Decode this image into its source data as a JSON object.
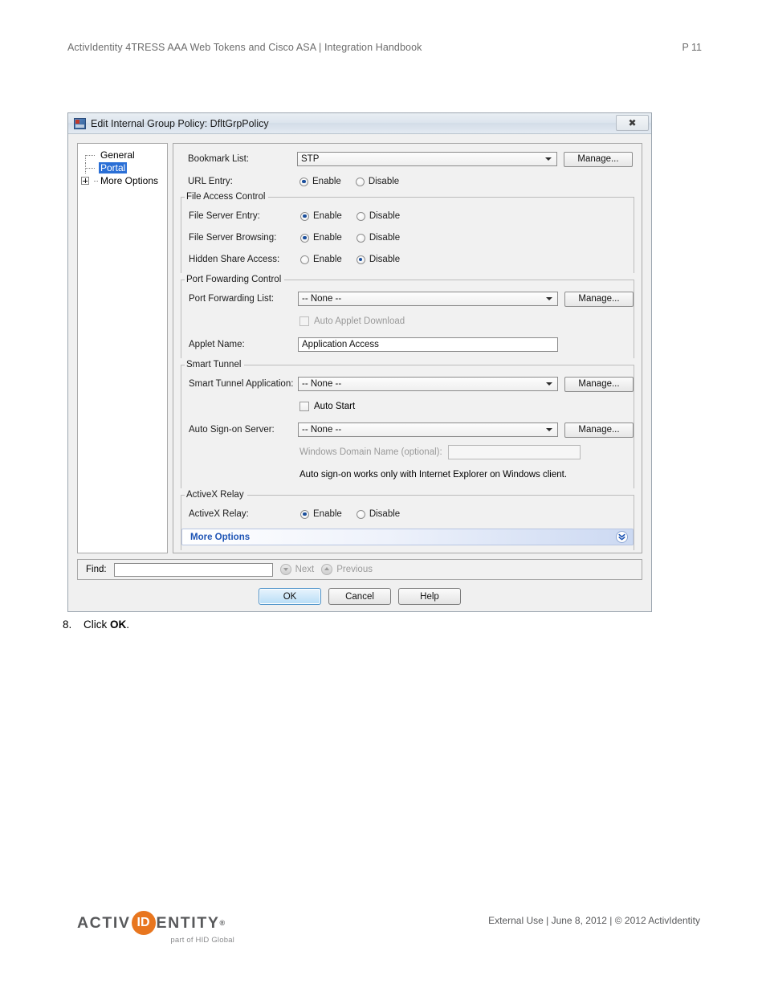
{
  "page_header": {
    "title": "ActivIdentity 4TRESS AAA Web Tokens and Cisco ASA | Integration Handbook",
    "page_number": "P 11"
  },
  "dialog": {
    "title": "Edit Internal Group Policy: DfltGrpPolicy",
    "close_label": "✖",
    "icon": "policy-window-icon",
    "tree": {
      "items": [
        {
          "label": "General",
          "selected": false,
          "expandable": false
        },
        {
          "label": "Portal",
          "selected": true,
          "expandable": false
        },
        {
          "label": "More Options",
          "selected": false,
          "expandable": true,
          "expander": "+"
        }
      ]
    },
    "fields": {
      "bookmark_list": {
        "label": "Bookmark List:",
        "value": "STP",
        "manage_label": "Manage..."
      },
      "url_entry": {
        "label": "URL Entry:",
        "enable_label": "Enable",
        "disable_label": "Disable",
        "selected": "Enable"
      }
    },
    "file_access_control": {
      "title": "File Access Control",
      "rows": [
        {
          "label": "File Server Entry:",
          "enable_label": "Enable",
          "disable_label": "Disable",
          "selected": "Enable"
        },
        {
          "label": "File Server Browsing:",
          "enable_label": "Enable",
          "disable_label": "Disable",
          "selected": "Enable"
        },
        {
          "label": "Hidden Share Access:",
          "enable_label": "Enable",
          "disable_label": "Disable",
          "selected": "Disable"
        }
      ]
    },
    "port_forwarding_control": {
      "title": "Port Fowarding Control",
      "list_label": "Port Forwarding List:",
      "list_value": "-- None --",
      "manage_label": "Manage...",
      "auto_applet_label": "Auto Applet Download",
      "auto_applet_checked": false,
      "auto_applet_disabled": true,
      "applet_name_label": "Applet Name:",
      "applet_name_value": "Application Access"
    },
    "smart_tunnel": {
      "title": "Smart Tunnel",
      "application_label": "Smart Tunnel Application:",
      "application_value": "-- None --",
      "application_manage_label": "Manage...",
      "auto_start_label": "Auto Start",
      "auto_start_checked": false,
      "auto_signon_label": "Auto Sign-on Server:",
      "auto_signon_value": "-- None --",
      "auto_signon_manage_label": "Manage...",
      "windows_domain_label": "Windows Domain Name (optional):",
      "windows_domain_value": "",
      "note": "Auto sign-on works only with Internet Explorer on Windows client."
    },
    "activex_relay": {
      "title": "ActiveX Relay",
      "label": "ActiveX Relay:",
      "enable_label": "Enable",
      "disable_label": "Disable",
      "selected": "Enable"
    },
    "more_options_bar": {
      "label": "More Options",
      "chevron": "»"
    },
    "find_bar": {
      "label": "Find:",
      "value": "",
      "next_label": "Next",
      "previous_label": "Previous"
    },
    "buttons": {
      "ok": "OK",
      "cancel": "Cancel",
      "help": "Help"
    }
  },
  "step": {
    "number": "8.",
    "text_before": "Click ",
    "bold": "OK",
    "text_after": "."
  },
  "footer": {
    "logo_part1": "ACTIV",
    "logo_oval": "ID",
    "logo_part2": "ENTITY",
    "logo_reg": "®",
    "logo_tagline": "part of HID Global",
    "text": "External Use | June 8, 2012 | © 2012 ActivIdentity"
  },
  "colors": {
    "accent_blue": "#1f55b5",
    "selection_blue": "#2a6fd6",
    "brand_orange": "#e8761f",
    "brand_gray": "#58595b"
  }
}
